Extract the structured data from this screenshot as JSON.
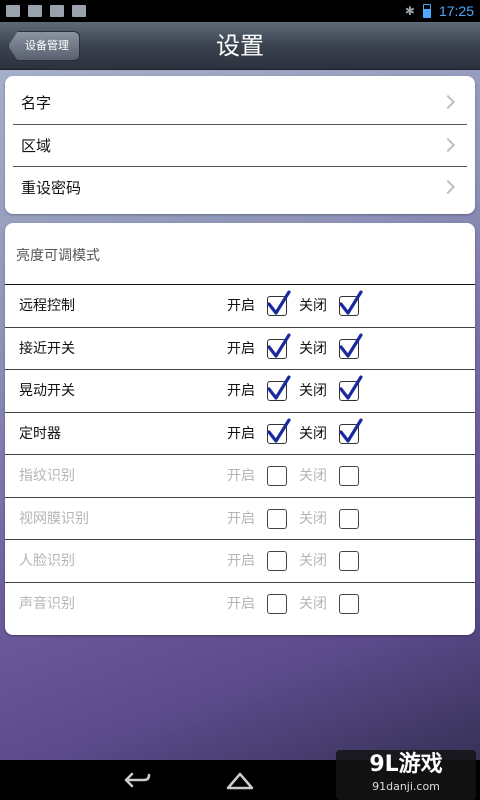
{
  "status_bar": {
    "time": "17:25"
  },
  "header": {
    "back_label": "设备管理",
    "title": "设置"
  },
  "menu": {
    "items": [
      {
        "label": "名字"
      },
      {
        "label": "区域"
      },
      {
        "label": "重设密码"
      }
    ]
  },
  "mode_section": {
    "title": "亮度可调模式",
    "rows": [
      {
        "name": "远程控制",
        "on_label": "开启",
        "off_label": "关闭",
        "on_checked": true,
        "off_checked": true,
        "enabled": true
      },
      {
        "name": "接近开关",
        "on_label": "开启",
        "off_label": "关闭",
        "on_checked": true,
        "off_checked": true,
        "enabled": true
      },
      {
        "name": "晃动开关",
        "on_label": "开启",
        "off_label": "关闭",
        "on_checked": true,
        "off_checked": true,
        "enabled": true
      },
      {
        "name": "定时器",
        "on_label": "开启",
        "off_label": "关闭",
        "on_checked": true,
        "off_checked": true,
        "enabled": true
      },
      {
        "name": "指纹识别",
        "on_label": "开启",
        "off_label": "关闭",
        "on_checked": false,
        "off_checked": false,
        "enabled": false
      },
      {
        "name": "视网膜识别",
        "on_label": "开启",
        "off_label": "关闭",
        "on_checked": false,
        "off_checked": false,
        "enabled": false
      },
      {
        "name": "人脸识别",
        "on_label": "开启",
        "off_label": "关闭",
        "on_checked": false,
        "off_checked": false,
        "enabled": false
      },
      {
        "name": "声音识别",
        "on_label": "开启",
        "off_label": "关闭",
        "on_checked": false,
        "off_checked": false,
        "enabled": false
      }
    ]
  },
  "watermark": {
    "brand": "9L游戏",
    "site": "91danji.com"
  },
  "colors": {
    "check": "#1a2a9c",
    "time": "#4da8ff"
  }
}
